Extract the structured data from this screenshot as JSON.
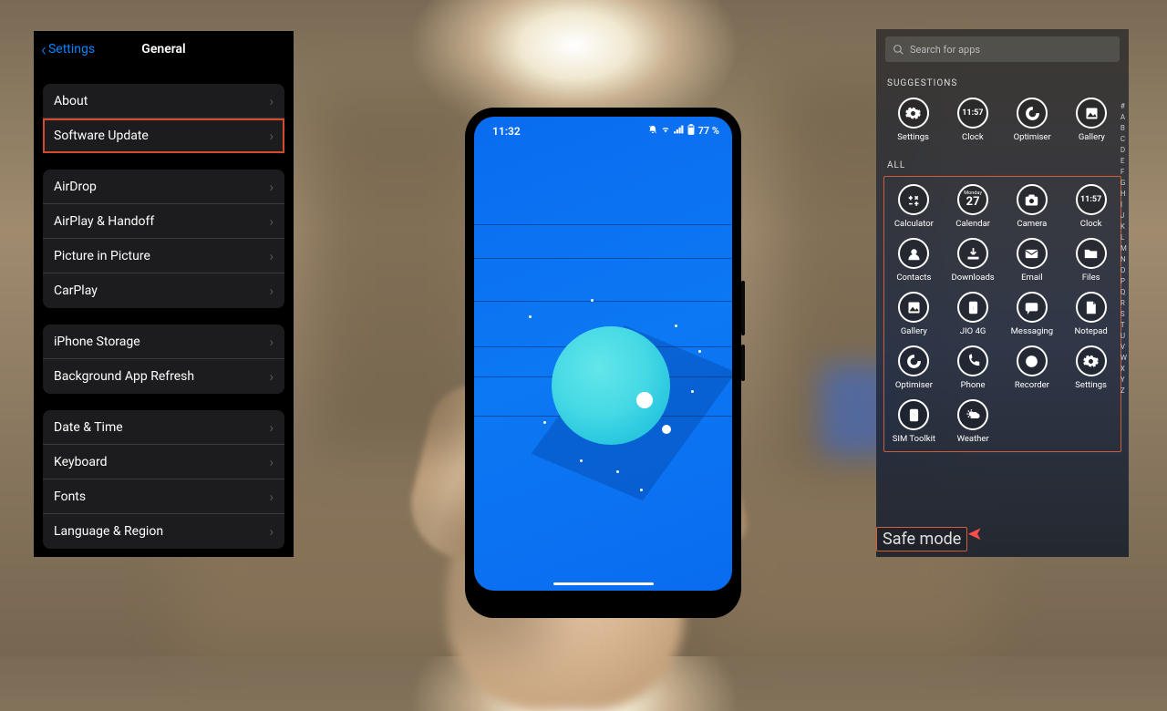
{
  "ios": {
    "back_label": "Settings",
    "title": "General",
    "groups": [
      {
        "rows": [
          {
            "label": "About",
            "highlight": false,
            "name": "about-row"
          },
          {
            "label": "Software Update",
            "highlight": true,
            "name": "software-update-row"
          }
        ]
      },
      {
        "rows": [
          {
            "label": "AirDrop",
            "highlight": false,
            "name": "airdrop-row"
          },
          {
            "label": "AirPlay & Handoff",
            "highlight": false,
            "name": "airplay-handoff-row"
          },
          {
            "label": "Picture in Picture",
            "highlight": false,
            "name": "pip-row"
          },
          {
            "label": "CarPlay",
            "highlight": false,
            "name": "carplay-row"
          }
        ]
      },
      {
        "rows": [
          {
            "label": "iPhone Storage",
            "highlight": false,
            "name": "iphone-storage-row"
          },
          {
            "label": "Background App Refresh",
            "highlight": false,
            "name": "background-refresh-row"
          }
        ]
      },
      {
        "rows": [
          {
            "label": "Date & Time",
            "highlight": false,
            "name": "date-time-row"
          },
          {
            "label": "Keyboard",
            "highlight": false,
            "name": "keyboard-row"
          },
          {
            "label": "Fonts",
            "highlight": false,
            "name": "fonts-row"
          },
          {
            "label": "Language & Region",
            "highlight": false,
            "name": "language-region-row"
          }
        ]
      }
    ]
  },
  "phone": {
    "status": {
      "time": "11:32",
      "battery": "77 %"
    }
  },
  "drawer": {
    "search_placeholder": "Search for apps",
    "heading_suggestions": "SUGGESTIONS",
    "heading_all": "ALL",
    "safe_mode_label": "Safe mode",
    "alpha": [
      "#",
      "A",
      "B",
      "C",
      "D",
      "E",
      "F",
      "G",
      "H",
      "I",
      "J",
      "K",
      "L",
      "M",
      "N",
      "O",
      "P",
      "Q",
      "R",
      "S",
      "T",
      "U",
      "V",
      "W",
      "X",
      "Y",
      "Z"
    ],
    "suggestions": [
      {
        "label": "Settings",
        "icon": "gear",
        "name": "app-settings"
      },
      {
        "label": "Clock",
        "icon": "clock",
        "name": "app-clock",
        "clock_text": "11:57"
      },
      {
        "label": "Optimiser",
        "icon": "optimise",
        "name": "app-optimiser"
      },
      {
        "label": "Gallery",
        "icon": "gallery",
        "name": "app-gallery"
      }
    ],
    "all": [
      {
        "label": "Calculator",
        "icon": "calc",
        "name": "app-calculator"
      },
      {
        "label": "Calendar",
        "icon": "calendar",
        "name": "app-calendar",
        "cal_text": "27",
        "cal_top": "Monday"
      },
      {
        "label": "Camera",
        "icon": "camera",
        "name": "app-camera"
      },
      {
        "label": "Clock",
        "icon": "clock",
        "name": "app-clock-2",
        "clock_text": "11:57"
      },
      {
        "label": "Contacts",
        "icon": "contact",
        "name": "app-contacts"
      },
      {
        "label": "Downloads",
        "icon": "download",
        "name": "app-downloads"
      },
      {
        "label": "Email",
        "icon": "email",
        "name": "app-email"
      },
      {
        "label": "Files",
        "icon": "folder",
        "name": "app-files"
      },
      {
        "label": "Gallery",
        "icon": "gallery",
        "name": "app-gallery-2"
      },
      {
        "label": "JIO 4G",
        "icon": "sim",
        "name": "app-jio4g"
      },
      {
        "label": "Messaging",
        "icon": "message",
        "name": "app-messaging"
      },
      {
        "label": "Notepad",
        "icon": "notepad",
        "name": "app-notepad"
      },
      {
        "label": "Optimiser",
        "icon": "optimise",
        "name": "app-optimiser-2"
      },
      {
        "label": "Phone",
        "icon": "phone",
        "name": "app-phone"
      },
      {
        "label": "Recorder",
        "icon": "recorder",
        "name": "app-recorder"
      },
      {
        "label": "Settings",
        "icon": "gear",
        "name": "app-settings-2"
      },
      {
        "label": "SIM Toolkit",
        "icon": "simtool",
        "name": "app-sim-toolkit"
      },
      {
        "label": "Weather",
        "icon": "weather",
        "name": "app-weather"
      }
    ]
  }
}
